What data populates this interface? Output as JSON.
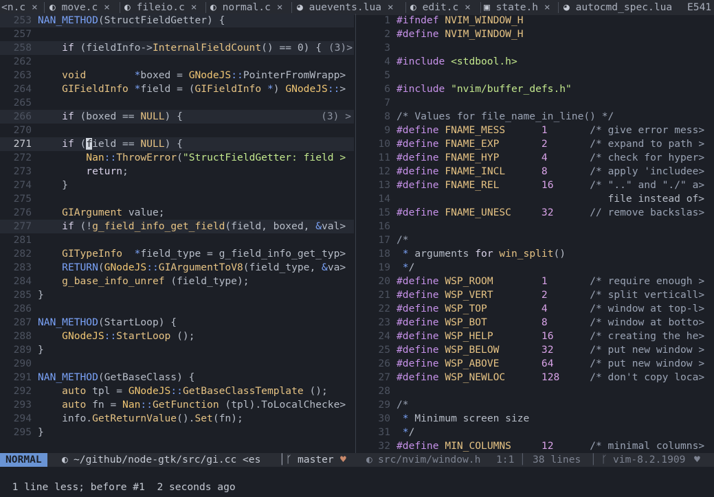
{
  "tabs": [
    {
      "label": "<n.c",
      "icon": "",
      "close": "×"
    },
    {
      "label": "move.c",
      "icon": "c-file-icon",
      "close": "×"
    },
    {
      "label": "fileio.c",
      "icon": "c-file-icon",
      "close": "×"
    },
    {
      "label": "normal.c",
      "icon": "c-file-icon",
      "close": "×"
    },
    {
      "label": "auevents.lua",
      "icon": "lua-file-icon",
      "close": "×"
    },
    {
      "label": "edit.c",
      "icon": "c-file-icon",
      "close": "×"
    },
    {
      "label": "state.h",
      "icon": "h-file-icon",
      "close": "×"
    },
    {
      "label": "autocmd_spec.lua",
      "icon": "lua-file-icon",
      "close": ""
    },
    {
      "label": "E541",
      "icon": "",
      "close": ""
    }
  ],
  "left": {
    "lines": [
      {
        "ln": "253",
        "text": "NAN_METHOD(StructFieldGetter) {"
      },
      {
        "ln": "257",
        "text": ""
      },
      {
        "ln": "258",
        "text": "    if (fieldInfo->InternalFieldCount() == 0) {",
        "fold": "(3)>"
      },
      {
        "ln": "262",
        "text": ""
      },
      {
        "ln": "263",
        "text": "    void        *boxed = GNodeJS::PointerFromWrapp>"
      },
      {
        "ln": "264",
        "text": "    GIFieldInfo *field = (GIFieldInfo *) GNodeJS::>"
      },
      {
        "ln": "265",
        "text": ""
      },
      {
        "ln": "266",
        "text": "    if (boxed == NULL) {",
        "fold": "(3) >"
      },
      {
        "ln": "270",
        "text": ""
      },
      {
        "ln": "271",
        "text": "    if (field == NULL) {"
      },
      {
        "ln": "272",
        "text": "        Nan::ThrowError(\"StructFieldGetter: field >"
      },
      {
        "ln": "273",
        "text": "        return;"
      },
      {
        "ln": "274",
        "text": "    }"
      },
      {
        "ln": "275",
        "text": ""
      },
      {
        "ln": "276",
        "text": "    GIArgument value;"
      },
      {
        "ln": "277",
        "text": "    if (!g_field_info_get_field(field, boxed, &val>"
      },
      {
        "ln": "281",
        "text": ""
      },
      {
        "ln": "282",
        "text": "    GITypeInfo  *field_type = g_field_info_get_typ>"
      },
      {
        "ln": "283",
        "text": "    RETURN(GNodeJS::GIArgumentToV8(field_type, &va>"
      },
      {
        "ln": "284",
        "text": "    g_base_info_unref (field_type);"
      },
      {
        "ln": "285",
        "text": "}"
      },
      {
        "ln": "286",
        "text": ""
      },
      {
        "ln": "287",
        "text": "NAN_METHOD(StartLoop) {"
      },
      {
        "ln": "288",
        "text": "    GNodeJS::StartLoop ();"
      },
      {
        "ln": "289",
        "text": "}"
      },
      {
        "ln": "290",
        "text": ""
      },
      {
        "ln": "291",
        "text": "NAN_METHOD(GetBaseClass) {"
      },
      {
        "ln": "292",
        "text": "    auto tpl = GNodeJS::GetBaseClassTemplate ();"
      },
      {
        "ln": "293",
        "text": "    auto fn = Nan::GetFunction (tpl).ToLocalChecke>"
      },
      {
        "ln": "294",
        "text": "    info.GetReturnValue().Set(fn);"
      },
      {
        "ln": "295",
        "text": "}"
      }
    ]
  },
  "right": {
    "lines": [
      {
        "ln": "1",
        "text": "#ifndef NVIM_WINDOW_H"
      },
      {
        "ln": "2",
        "text": "#define NVIM_WINDOW_H"
      },
      {
        "ln": "3",
        "text": ""
      },
      {
        "ln": "4",
        "text": "#include <stdbool.h>"
      },
      {
        "ln": "5",
        "text": ""
      },
      {
        "ln": "6",
        "text": "#include \"nvim/buffer_defs.h\""
      },
      {
        "ln": "7",
        "text": ""
      },
      {
        "ln": "8",
        "text": "/* Values for file_name_in_line() */"
      },
      {
        "ln": "9",
        "text": "#define FNAME_MESS      1       /* give error mess>"
      },
      {
        "ln": "10",
        "text": "#define FNAME_EXP       2       /* expand to path >"
      },
      {
        "ln": "11",
        "text": "#define FNAME_HYP       4       /* check for hyper>"
      },
      {
        "ln": "12",
        "text": "#define FNAME_INCL      8       /* apply 'includee>"
      },
      {
        "ln": "13",
        "text": "#define FNAME_REL       16      /* \"..\" and \"./\" a>"
      },
      {
        "ln": "14",
        "text": "                                   file instead of>"
      },
      {
        "ln": "15",
        "text": "#define FNAME_UNESC     32      // remove backslas>"
      },
      {
        "ln": "16",
        "text": ""
      },
      {
        "ln": "17",
        "text": "/*"
      },
      {
        "ln": "18",
        "text": " * arguments for win_split()"
      },
      {
        "ln": "19",
        "text": " */"
      },
      {
        "ln": "20",
        "text": "#define WSP_ROOM        1       /* require enough >"
      },
      {
        "ln": "21",
        "text": "#define WSP_VERT        2       /* split verticall>"
      },
      {
        "ln": "22",
        "text": "#define WSP_TOP         4       /* window at top-l>"
      },
      {
        "ln": "23",
        "text": "#define WSP_BOT         8       /* window at botto>"
      },
      {
        "ln": "24",
        "text": "#define WSP_HELP        16      /* creating the he>"
      },
      {
        "ln": "25",
        "text": "#define WSP_BELOW       32      /* put new window >"
      },
      {
        "ln": "26",
        "text": "#define WSP_ABOVE       64      /* put new window >"
      },
      {
        "ln": "27",
        "text": "#define WSP_NEWLOC      128     /* don't copy loca>"
      },
      {
        "ln": "28",
        "text": ""
      },
      {
        "ln": "29",
        "text": "/*"
      },
      {
        "ln": "30",
        "text": " * Minimum screen size"
      },
      {
        "ln": "31",
        "text": " */"
      },
      {
        "ln": "32",
        "text": "#define MIN_COLUMNS     12      /* minimal columns>"
      }
    ]
  },
  "statusline": {
    "mode": "NORMAL",
    "left_file": "~/github/node-gtk/src/gi.cc <es",
    "branch": "master",
    "right_file": "src/nvim/window.h",
    "position": "1:1",
    "lines": "38 lines",
    "version": "vim-8.2.1909"
  },
  "cmdline": {
    "message": "1 line less; before #1  2 seconds ago"
  },
  "colors": {
    "background": "#1c1f26",
    "mode_bg": "#6a94d4",
    "keyword": "#c792ea",
    "function": "#e6c384",
    "string": "#c3e88d"
  }
}
